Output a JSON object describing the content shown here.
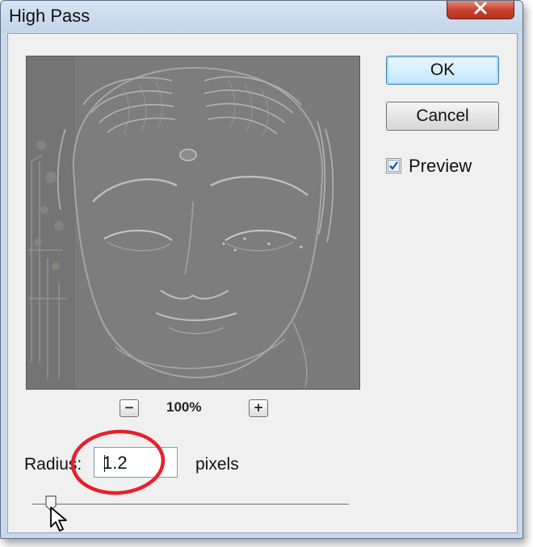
{
  "window": {
    "title": "High Pass"
  },
  "buttons": {
    "ok": "OK",
    "cancel": "Cancel"
  },
  "preview_option": {
    "label": "Preview",
    "checked": true
  },
  "zoom": {
    "minus_icon": "zoom-out-icon",
    "plus_icon": "zoom-in-icon",
    "level": "100%"
  },
  "radius": {
    "label": "Radius:",
    "value": "1.2",
    "unit": "pixels",
    "slider_value": 1.2
  },
  "annotation": {
    "color": "#e8202a"
  },
  "colors": {
    "title_bar": "#c9d9ea",
    "close_button": "#c9432f",
    "preview_gray": "#7a7a7a"
  }
}
